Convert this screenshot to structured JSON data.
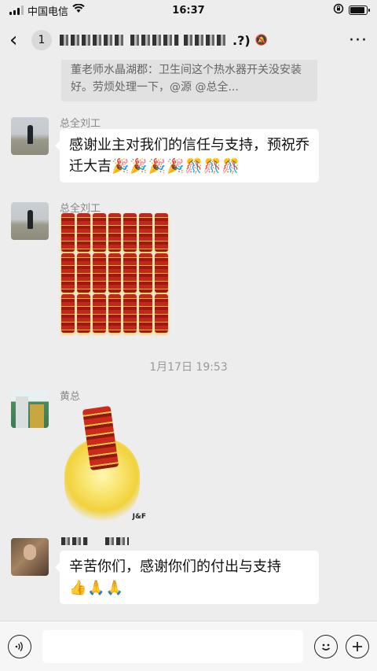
{
  "status_bar": {
    "carrier": "中国电信",
    "time": "16:37"
  },
  "nav": {
    "back_icon": "chevron-left-icon",
    "unread_count": "1",
    "title_suffix": ".?)",
    "more": "···"
  },
  "quote": {
    "text": "董老师水晶湖郡：卫生间这个热水器开关没安装好。劳烦处理一下，@源 @总全..."
  },
  "messages": [
    {
      "sender": "总全刘工",
      "text": "感谢业主对我们的信任与支持，预祝乔迁大吉",
      "emoji": "🎉🎉🎉🎉🎊🎊🎊"
    },
    {
      "sender": "总全刘工",
      "sticker": "firecrackers-grid"
    },
    {
      "sender": "黄总",
      "sticker": "firecracker-burst",
      "sticker_logo": "J&F"
    },
    {
      "text": "辛苦你们，感谢你们的付出与支持",
      "emoji": "👍🙏🙏"
    }
  ],
  "time_separator": "1月17日 19:53",
  "colors": {
    "background": "#ededed",
    "bubble": "#ffffff",
    "meta_text": "#888888"
  }
}
